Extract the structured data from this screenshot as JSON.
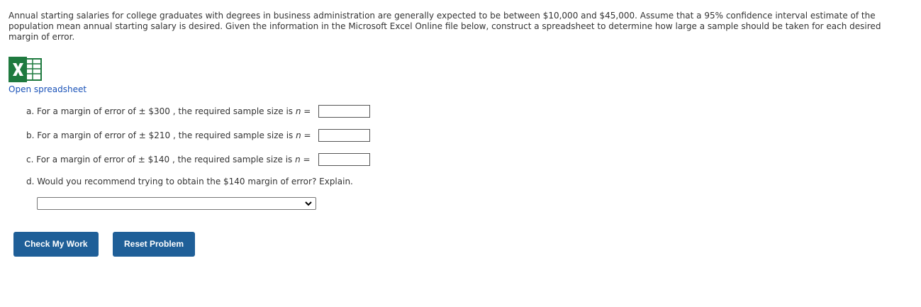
{
  "intro": {
    "text": "Annual starting salaries for college graduates with degrees in business administration are generally expected to be between $10,000 and $45,000. Assume that a 95% confidence interval estimate of the population mean annual starting salary is desired. Given the information in the Microsoft Excel Online file below, construct a spreadsheet to determine how large a sample should be taken for each desired margin of error."
  },
  "spreadsheet": {
    "icon": "excel-icon",
    "link_label": "Open spreadsheet"
  },
  "questions": {
    "a": {
      "prefix": "a. For a margin of error of ± $300 , the required sample size is ",
      "n": "n",
      "suffix": " =",
      "value": ""
    },
    "b": {
      "prefix": "b. For a margin of error of ± $210 , the required sample size is ",
      "n": "n",
      "suffix": " =",
      "value": ""
    },
    "c": {
      "prefix": "c. For a margin of error of ± $140 , the required sample size is ",
      "n": "n",
      "suffix": " =",
      "value": ""
    },
    "d": {
      "text": "d. Would you recommend trying to obtain the $140 margin of error? Explain."
    }
  },
  "recommendation_select": {
    "selected": ""
  },
  "buttons": {
    "check_label": "Check My Work",
    "reset_label": "Reset Problem"
  },
  "colors": {
    "button_bg": "#1f5f98",
    "link": "#1a52b8",
    "excel_green": "#1f7a3f"
  }
}
